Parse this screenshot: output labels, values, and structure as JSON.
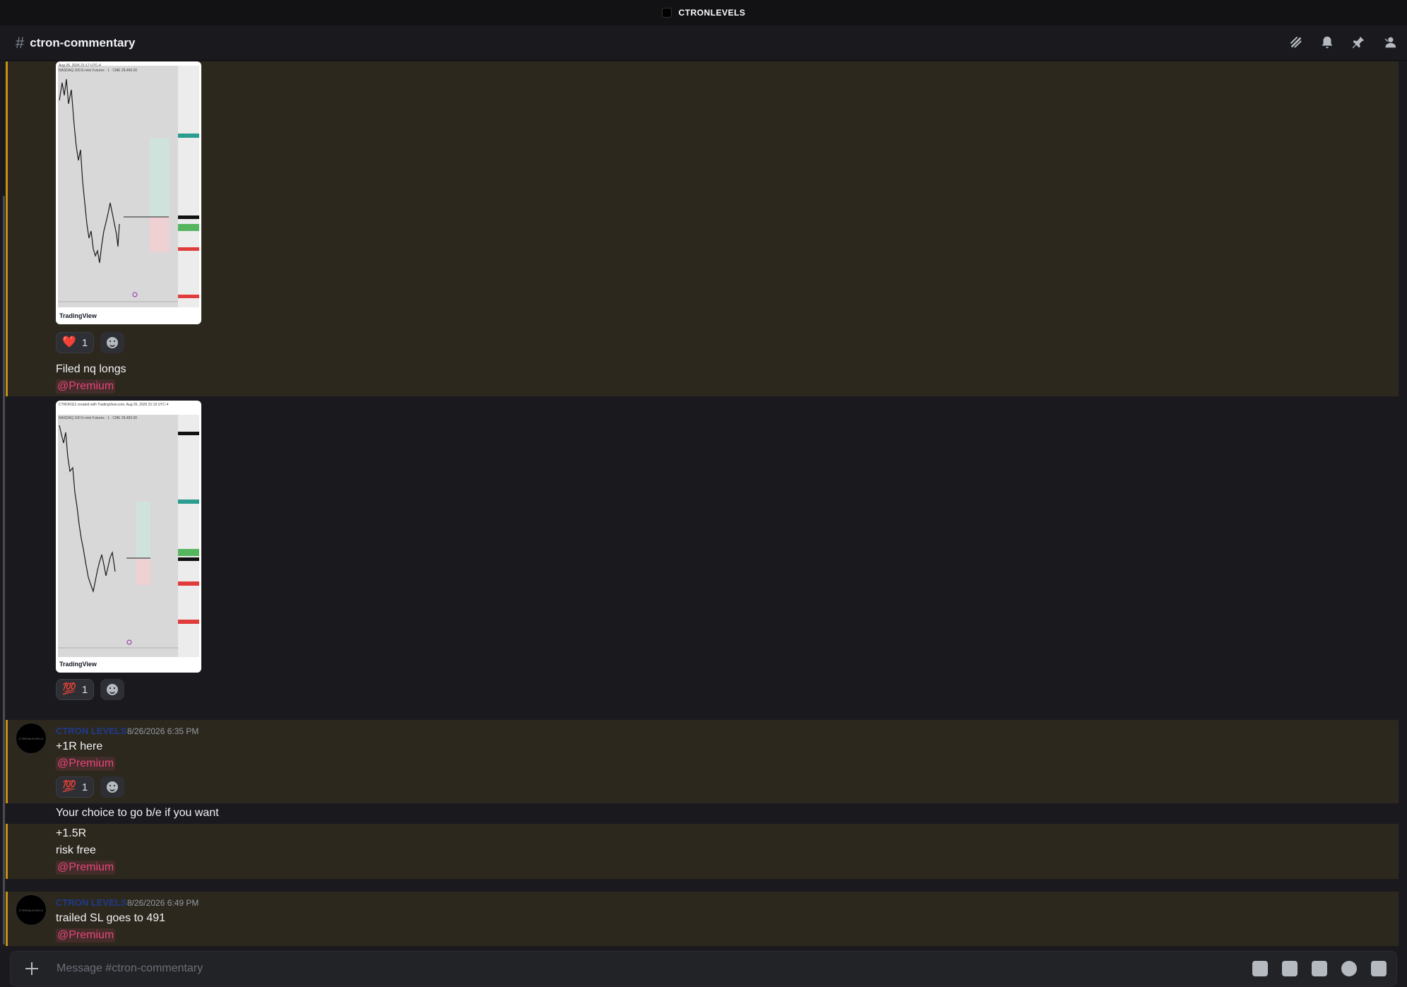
{
  "app": {
    "title": "CTRONLEVELS"
  },
  "channel": {
    "name": "ctron-commentary",
    "composer_placeholder": "Message #ctron-commentary"
  },
  "header_icons": [
    "threads-icon",
    "bell-icon",
    "pin-icon",
    "members-icon"
  ],
  "messages": [
    {
      "id": "m1",
      "image": {
        "header": "Aug 26, 2026 21:17 UTC-4",
        "title": "NASDAQ 100 E-mini Futures · 1 · CME  28,466.00",
        "brand": "TradingView"
      },
      "reactions": [
        {
          "emoji": "❤️",
          "count": "1"
        }
      ]
    },
    {
      "id": "m2",
      "text": "Filed nq longs",
      "mention": "@Premium"
    },
    {
      "id": "m3",
      "image": {
        "header": "CTRON111 created with TradingView.com, Aug 26, 2026 21:19 UTC-4",
        "title": "NASDAQ 100 E-mini Futures · 1 · CME  28,483.00",
        "brand": "TradingView"
      },
      "reactions": [
        {
          "emoji": "💯",
          "count": "1"
        }
      ]
    },
    {
      "id": "m4",
      "author": "CTRON LEVELS",
      "timestamp": "8/26/2026 6:35 PM",
      "text": "+1R here",
      "mention": "@Premium",
      "reactions": [
        {
          "emoji": "💯",
          "count": "1"
        }
      ]
    },
    {
      "id": "m5",
      "text": "Your choice to go b/e if you want"
    },
    {
      "id": "m6",
      "lines": [
        "+1.5R",
        "risk free"
      ],
      "mention": "@Premium"
    },
    {
      "id": "m7",
      "author": "CTRON LEVELS",
      "timestamp": "8/26/2026 6:49 PM",
      "text": "trailed SL goes to 491",
      "mention": "@Premium"
    }
  ],
  "colors": {
    "highlight_bg": "#2d281e",
    "highlight_bar": "#c78f12",
    "mention": "#e6467a",
    "author": "#1e3a8a"
  },
  "composer_icons": [
    "gift-icon",
    "gif-icon",
    "sticker-icon",
    "emoji-icon",
    "apps-icon"
  ]
}
